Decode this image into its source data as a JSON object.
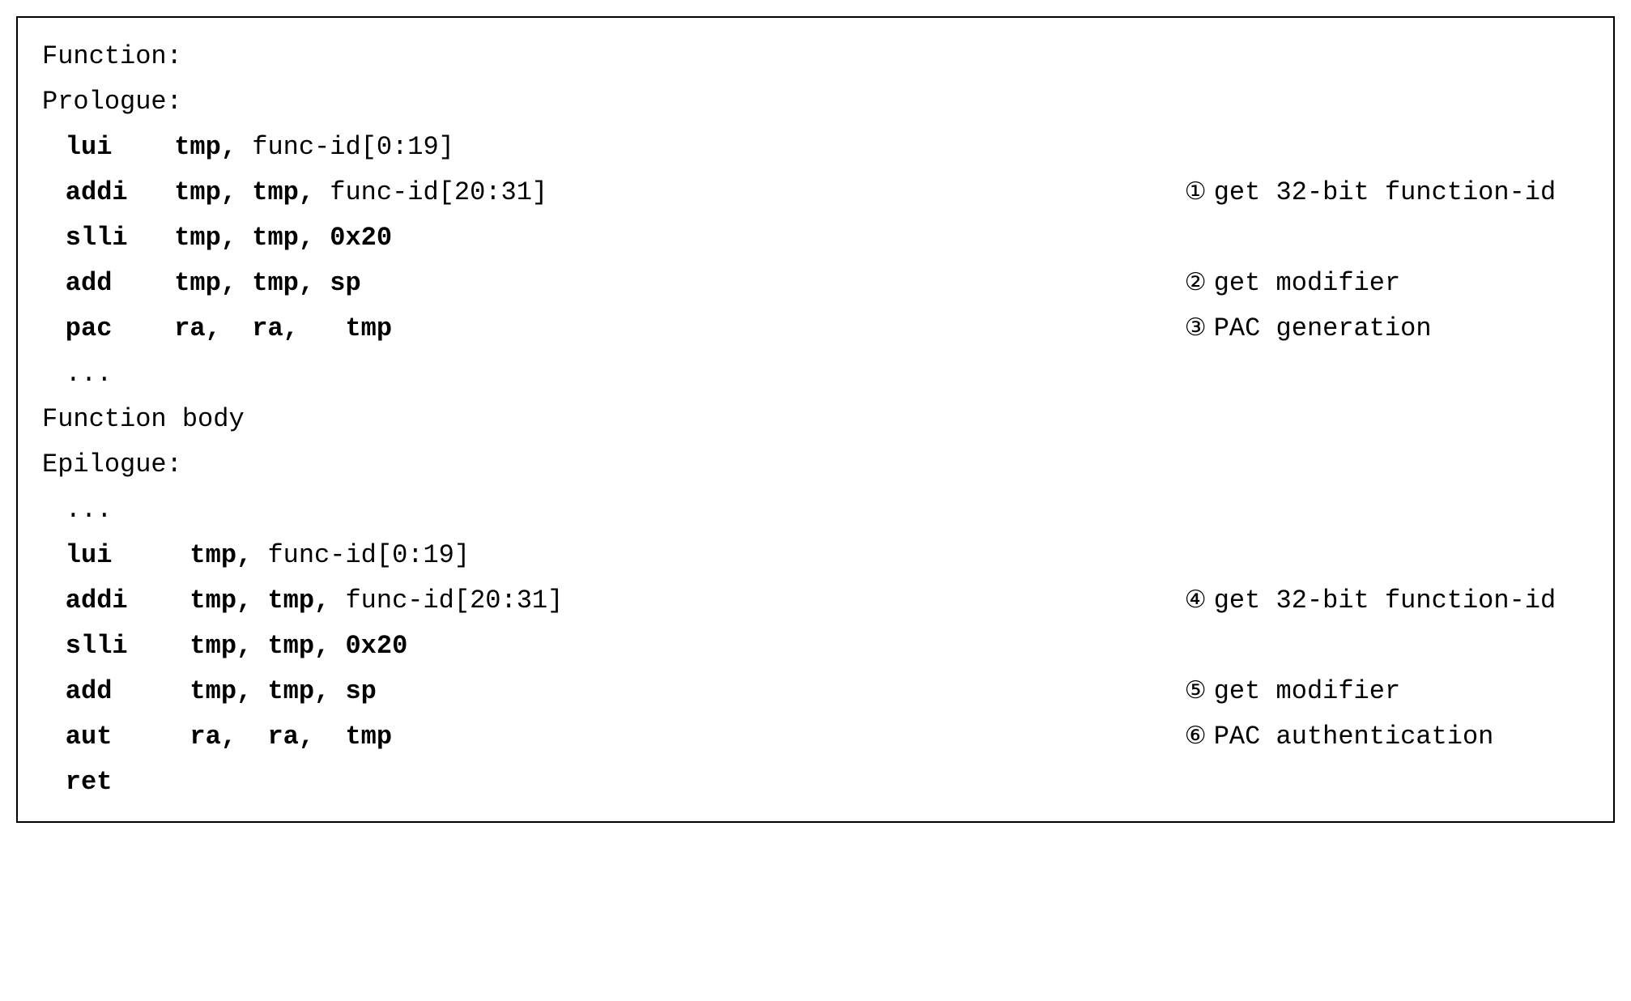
{
  "headers": {
    "function": "Function:",
    "prologue": "Prologue:",
    "body": "Function body",
    "epilogue": "Epilogue:"
  },
  "prologue": {
    "lines": [
      {
        "mnemonic": "lui",
        "op_bold_a": "tmp,",
        "op_plain": " func-id[0:19]"
      },
      {
        "mnemonic": "addi",
        "op_bold_a": "tmp,",
        "op_bold_b": " tmp,",
        "op_plain": " func-id[20:31]",
        "circled": "①",
        "annotation": "get 32-bit function-id"
      },
      {
        "mnemonic": "slli",
        "op_bold_a": "tmp,",
        "op_bold_b": " tmp,",
        "op_bold_c": " 0x20"
      },
      {
        "mnemonic": "add",
        "op_bold_a": "tmp,",
        "op_bold_b": " tmp,",
        "op_bold_c": " sp",
        "circled": "②",
        "annotation": "get modifier"
      },
      {
        "mnemonic": "pac",
        "op_bold_a": "ra,",
        "op_bold_b": "  ra,",
        "op_bold_c": "   tmp",
        "circled": "③",
        "annotation": "PAC generation"
      }
    ],
    "ellipsis": "..."
  },
  "epilogue": {
    "ellipsis": "...",
    "lines": [
      {
        "mnemonic": "lui",
        "op_bold_a": " tmp,",
        "op_plain": " func-id[0:19]"
      },
      {
        "mnemonic": "addi",
        "op_bold_a": " tmp,",
        "op_bold_b": " tmp,",
        "op_plain": " func-id[20:31]",
        "circled": "④",
        "annotation": "get 32-bit function-id"
      },
      {
        "mnemonic": "slli",
        "op_bold_a": " tmp,",
        "op_bold_b": " tmp,",
        "op_bold_c": " 0x20"
      },
      {
        "mnemonic": "add",
        "op_bold_a": " tmp,",
        "op_bold_b": " tmp,",
        "op_bold_c": " sp",
        "circled": "⑤",
        "annotation": "get modifier"
      },
      {
        "mnemonic": "aut",
        "op_bold_a": " ra,",
        "op_bold_b": "  ra,",
        "op_bold_c": "  tmp",
        "circled": "⑥",
        "annotation": "PAC authentication"
      }
    ],
    "ret": "ret"
  }
}
